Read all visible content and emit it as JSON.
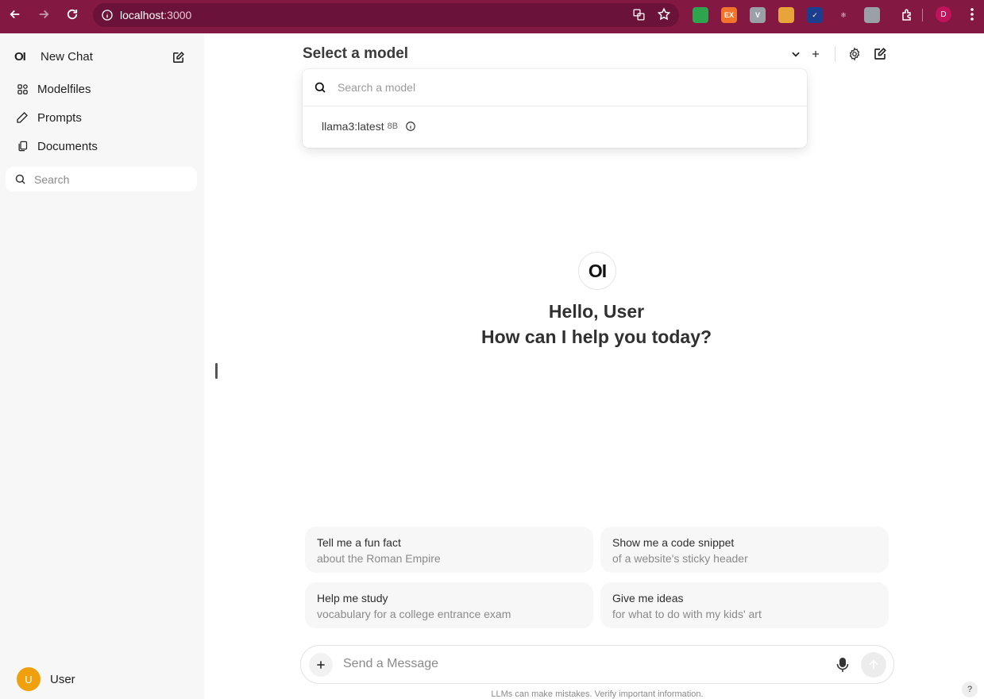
{
  "browser": {
    "url_host": "localhost",
    "url_port": ":3000",
    "profile_initial": "D",
    "extensions": [
      {
        "name": "mail-extension-icon",
        "label": "",
        "color": "#2fa44f"
      },
      {
        "name": "ex-extension-icon",
        "label": "EX",
        "color": "#f1742a"
      },
      {
        "name": "vue-extension-icon",
        "label": "V",
        "color": "#9aa0a6"
      },
      {
        "name": "color-extension-icon",
        "label": "",
        "color": "#e8a33b"
      },
      {
        "name": "check-extension-icon",
        "label": "✓",
        "color": "#1d3d8f"
      },
      {
        "name": "react-extension-icon",
        "label": "⚛",
        "color": "#831843"
      },
      {
        "name": "database-extension-icon",
        "label": "",
        "color": "#9aa0a6"
      }
    ]
  },
  "sidebar": {
    "logo": "OI",
    "new_chat": "New Chat",
    "items": [
      {
        "label": "Modelfiles",
        "icon": "grid-icon"
      },
      {
        "label": "Prompts",
        "icon": "pencil-icon"
      },
      {
        "label": "Documents",
        "icon": "documents-icon"
      }
    ],
    "search_placeholder": "Search",
    "user": {
      "initial": "U",
      "name": "User"
    }
  },
  "header": {
    "title": "Select a model"
  },
  "model_dropdown": {
    "search_placeholder": "Search a model",
    "items": [
      {
        "name": "llama3:latest",
        "size": "8B"
      }
    ]
  },
  "greeting": {
    "logo": "OI",
    "line1": "Hello, User",
    "line2": "How can I help you today?"
  },
  "suggestions": [
    {
      "title": "Tell me a fun fact",
      "subtitle": "about the Roman Empire"
    },
    {
      "title": "Show me a code snippet",
      "subtitle": "of a website's sticky header"
    },
    {
      "title": "Help me study",
      "subtitle": "vocabulary for a college entrance exam"
    },
    {
      "title": "Give me ideas",
      "subtitle": "for what to do with my kids' art"
    }
  ],
  "composer": {
    "placeholder": "Send a Message",
    "disclaimer": "LLMs can make mistakes. Verify important information.",
    "help": "?"
  },
  "colors": {
    "browser_bar": "#831843",
    "sidebar_bg": "#f7f7f7",
    "avatar": "#f0a00c"
  }
}
